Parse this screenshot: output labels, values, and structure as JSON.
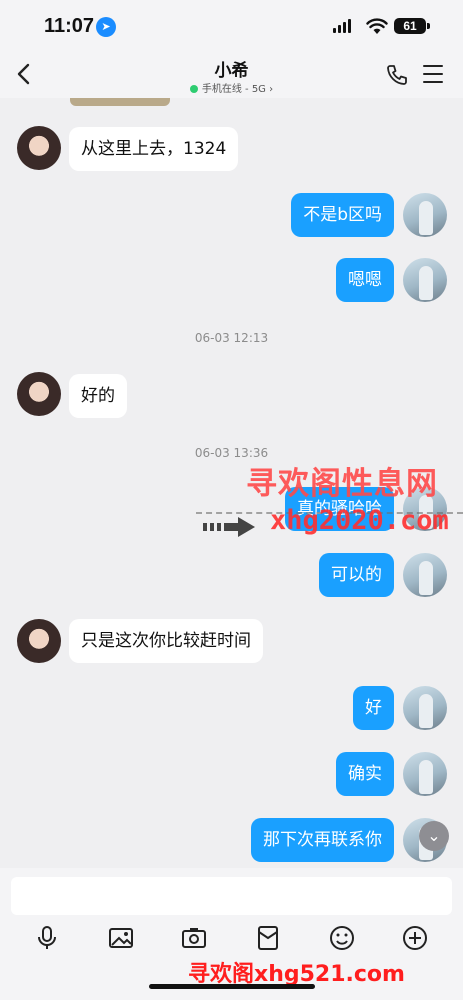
{
  "status": {
    "time": "11:07",
    "battery": "61"
  },
  "header": {
    "title": "小希",
    "online": "手机在线 - 5G"
  },
  "messages": [
    {
      "side": "in",
      "text": "从这里上去，1324"
    },
    {
      "side": "out",
      "text": "不是b区吗"
    },
    {
      "side": "out",
      "text": "嗯嗯"
    },
    {
      "side": "in",
      "text": "好的"
    },
    {
      "side": "out",
      "text": "真的骚哈哈"
    },
    {
      "side": "out",
      "text": "可以的"
    },
    {
      "side": "in",
      "text": "只是这次你比较赶时间"
    },
    {
      "side": "out",
      "text": "好"
    },
    {
      "side": "out",
      "text": "确实"
    },
    {
      "side": "out",
      "text": "那下次再联系你"
    }
  ],
  "timestamps": [
    "06-03 12:13",
    "06-03 13:36"
  ],
  "watermark": {
    "top": "寻欢阁性息网",
    "mid": "xhg2020.com",
    "bottom": "寻欢阁xhg521.com"
  },
  "input": {
    "placeholder": ""
  },
  "toolbar": [
    "mic-icon",
    "image-icon",
    "camera-icon",
    "red-packet-icon",
    "emoji-icon",
    "plus-icon"
  ]
}
